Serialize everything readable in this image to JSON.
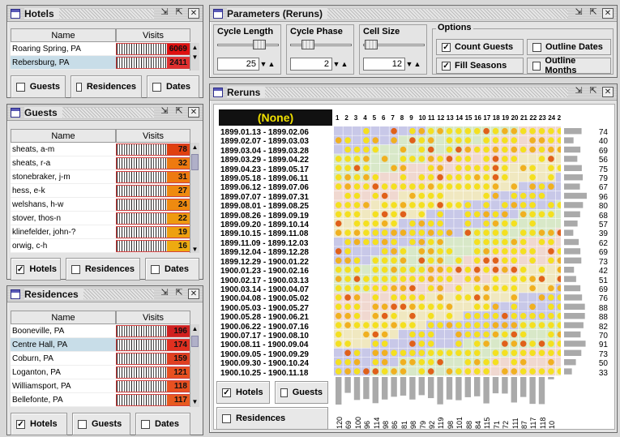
{
  "hotels": {
    "title": "Hotels",
    "col_name": "Name",
    "col_visits": "Visits",
    "rows": [
      {
        "name": "Roaring Spring, PA",
        "visits": "6069",
        "color": "#e01010",
        "selected": false
      },
      {
        "name": "Rebersburg, PA",
        "visits": "2411",
        "color": "#e03030",
        "selected": true
      }
    ],
    "toggles": [
      "Guests",
      "Residences",
      "Dates"
    ]
  },
  "guests": {
    "title": "Guests",
    "col_name": "Name",
    "col_visits": "Visits",
    "rows": [
      {
        "name": "sheats, a-m",
        "visits": "78",
        "color": "#e04010"
      },
      {
        "name": "sheats, r-a",
        "visits": "32",
        "color": "#ee7a10"
      },
      {
        "name": "stonebraker, j-m",
        "visits": "31",
        "color": "#ee7a10"
      },
      {
        "name": "hess, e-k",
        "visits": "27",
        "color": "#ee8a10"
      },
      {
        "name": "welshans, h-w",
        "visits": "24",
        "color": "#ee8a10"
      },
      {
        "name": "stover, thos-n",
        "visits": "22",
        "color": "#ee9a10"
      },
      {
        "name": "klinefelder, john-?",
        "visits": "19",
        "color": "#eea010"
      },
      {
        "name": "orwig, c-h",
        "visits": "16",
        "color": "#eeaa10"
      }
    ],
    "toggles": [
      "Hotels",
      "Residences",
      "Dates"
    ],
    "checked": [
      true,
      false,
      false
    ]
  },
  "residences": {
    "title": "Residences",
    "col_name": "Name",
    "col_visits": "Visits",
    "rows": [
      {
        "name": "Booneville, PA",
        "visits": "196",
        "color": "#d02020",
        "selected": false
      },
      {
        "name": "Centre Hall, PA",
        "visits": "174",
        "color": "#e03020",
        "selected": true
      },
      {
        "name": "Coburn, PA",
        "visits": "159",
        "color": "#e04020",
        "selected": false
      },
      {
        "name": "Loganton, PA",
        "visits": "121",
        "color": "#e85020",
        "selected": false
      },
      {
        "name": "Williamsport, PA",
        "visits": "118",
        "color": "#e85020",
        "selected": false
      },
      {
        "name": "Bellefonte, PA",
        "visits": "117",
        "color": "#e85a20",
        "selected": false
      }
    ],
    "toggles": [
      "Hotels",
      "Guests",
      "Dates"
    ],
    "checked": [
      true,
      false,
      false
    ]
  },
  "params": {
    "title": "Parameters (Reruns)",
    "cycle_length_label": "Cycle Length",
    "cycle_length_value": "25",
    "cycle_phase_label": "Cycle Phase",
    "cycle_phase_value": "2",
    "cell_size_label": "Cell Size",
    "cell_size_value": "12",
    "options_label": "Options",
    "options": [
      {
        "label": "Count Guests",
        "checked": true
      },
      {
        "label": "Outline Dates",
        "checked": false
      },
      {
        "label": "Fill Seasons",
        "checked": true
      },
      {
        "label": "Outline Months",
        "checked": false
      }
    ]
  },
  "reruns": {
    "title": "Reruns",
    "none_label": "(None)",
    "columns": [
      "1",
      "2",
      "3",
      "4",
      "5",
      "6",
      "7",
      "8",
      "9",
      "10",
      "11",
      "12",
      "13",
      "14",
      "15",
      "16",
      "17",
      "18",
      "19",
      "20",
      "21",
      "22",
      "23",
      "24",
      "2"
    ],
    "dates": [
      "1899.01.13 - 1899.02.06",
      "1899.02.07 - 1899.03.03",
      "1899.03.04 - 1899.03.28",
      "1899.03.29 - 1899.04.22",
      "1899.04.23 - 1899.05.17",
      "1899.05.18 - 1899.06.11",
      "1899.06.12 - 1899.07.06",
      "1899.07.07 - 1899.07.31",
      "1899.08.01 - 1899.08.25",
      "1899.08.26 - 1899.09.19",
      "1899.09.20 - 1899.10.14",
      "1899.10.15 - 1899.11.08",
      "1899.11.09 - 1899.12.03",
      "1899.12.04 - 1899.12.28",
      "1899.12.29 - 1900.01.22",
      "1900.01.23 - 1900.02.16",
      "1900.02.17 - 1900.03.13",
      "1900.03.14 - 1900.04.07",
      "1900.04.08 - 1900.05.02",
      "1900.05.03 - 1900.05.27",
      "1900.05.28 - 1900.06.21",
      "1900.06.22 - 1900.07.16",
      "1900.07.17 - 1900.08.10",
      "1900.08.11 - 1900.09.04",
      "1900.09.05 - 1900.09.29",
      "1900.09.30 - 1900.10.24",
      "1900.10.25 - 1900.11.18"
    ],
    "row_totals": [
      74,
      40,
      69,
      56,
      75,
      79,
      67,
      96,
      80,
      68,
      57,
      39,
      62,
      69,
      73,
      42,
      51,
      69,
      76,
      88,
      88,
      82,
      70,
      91,
      73,
      50,
      33
    ],
    "col_totals": [
      "120",
      "69",
      "100",
      "96",
      "114",
      "98",
      "86",
      "81",
      "98",
      "79",
      "92",
      "119",
      "98",
      "101",
      "88",
      "84",
      "115",
      "71",
      "72",
      "111",
      "87",
      "117",
      "118",
      "10"
    ],
    "toggles": [
      "Hotels",
      "Guests",
      "Residences"
    ],
    "checked": [
      true,
      false,
      false
    ]
  }
}
